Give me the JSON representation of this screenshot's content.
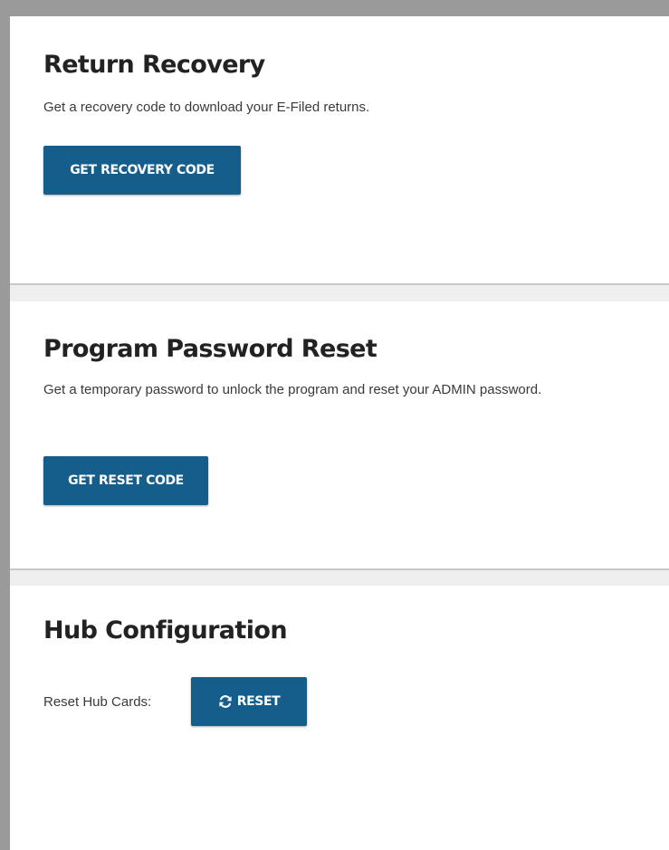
{
  "return_recovery": {
    "title": "Return Recovery",
    "description": "Get a recovery code to download your E-Filed returns.",
    "button_label": "GET RECOVERY CODE"
  },
  "password_reset": {
    "title": "Program Password Reset",
    "description": "Get a temporary password to unlock the program and reset your ADMIN password.",
    "button_label": "GET RESET CODE"
  },
  "hub_configuration": {
    "title": "Hub Configuration",
    "reset_label": "Reset Hub Cards:",
    "reset_button_label": "RESET",
    "reset_button_icon": "refresh-icon"
  },
  "colors": {
    "button_bg": "#155e8c",
    "button_text": "#ffffff",
    "title_text": "#222222",
    "body_text": "#3a3a3a",
    "panel_bg": "#ffffff"
  }
}
